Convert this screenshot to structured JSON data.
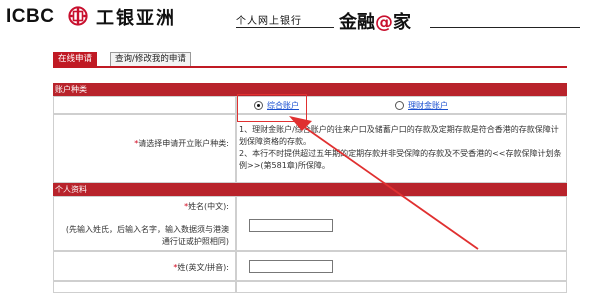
{
  "header": {
    "brand_latin": "ICBC",
    "bank_name": "工银亚洲",
    "ebank_label": "个人网上银行",
    "portal_name_prefix": "金融",
    "portal_name_at": "@",
    "portal_name_suffix": "家",
    "logo_icon": "icbc-logo-icon",
    "accent_color": "#c8102e"
  },
  "tabs": [
    {
      "label": "在线申请",
      "active": true
    },
    {
      "label": "查询/修改我的申请",
      "active": false
    }
  ],
  "sections": {
    "account_type": "账户种类",
    "personal_info": "个人资料"
  },
  "account_type": {
    "question_label": "请选择申请开立账户种类:",
    "options": [
      {
        "label": "综合账户",
        "selected": true
      },
      {
        "label": "理财金账户",
        "selected": false
      }
    ],
    "note1": "1、理财金账户/综合账户的往来户口及储蓄户口的存款及定期存款是符合香港的存款保障计划保障资格的存款。",
    "note2": "2、本行不时提供超过五年期的定期存款并非受保障的存款及不受香港的<<存款保障计划条例>>(第581章)所保障。"
  },
  "personal_info": {
    "name_cn_label": "姓名(中文):",
    "name_hint": "(先输入姓氏，后输入名字，输入数据须与港澳通行证或护照相同)",
    "surname_en_label": "姓(英文/拼音):"
  },
  "colors": {
    "section_bar": "#b8232b",
    "tab_active": "#c01a24",
    "annotation": "#e03030",
    "link": "#1a4fd0"
  }
}
